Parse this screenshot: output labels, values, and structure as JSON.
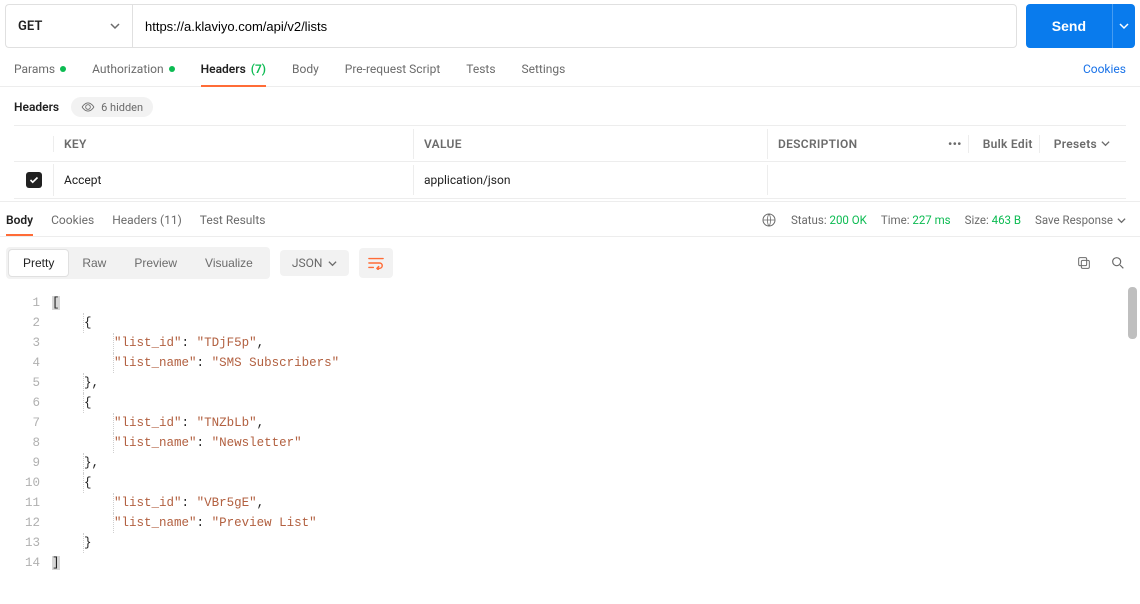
{
  "urlbar": {
    "method": "GET",
    "url": "https://a.klaviyo.com/api/v2/lists",
    "send": "Send"
  },
  "request_tabs": {
    "params": "Params",
    "authorization": "Authorization",
    "headers": "Headers",
    "headers_count": "(7)",
    "body": "Body",
    "prerequest": "Pre-request Script",
    "tests": "Tests",
    "settings": "Settings",
    "cookies": "Cookies"
  },
  "headers_section": {
    "label": "Headers",
    "hidden": "6 hidden",
    "columns": {
      "key": "KEY",
      "value": "VALUE",
      "description": "DESCRIPTION"
    },
    "actions": {
      "bulk_edit": "Bulk Edit",
      "presets": "Presets"
    },
    "rows": [
      {
        "key": "Accept",
        "value": "application/json",
        "description": ""
      }
    ]
  },
  "response_tabs": {
    "body": "Body",
    "cookies": "Cookies",
    "headers": "Headers",
    "headers_count": "(11)",
    "test_results": "Test Results"
  },
  "response_meta": {
    "status_label": "Status:",
    "status_value": "200 OK",
    "time_label": "Time:",
    "time_value": "227 ms",
    "size_label": "Size:",
    "size_value": "463 B",
    "save": "Save Response"
  },
  "response_view": {
    "pretty": "Pretty",
    "raw": "Raw",
    "preview": "Preview",
    "visualize": "Visualize",
    "format": "JSON"
  },
  "response_body": [
    {
      "list_id": "TDjF5p",
      "list_name": "SMS Subscribers"
    },
    {
      "list_id": "TNZbLb",
      "list_name": "Newsletter"
    },
    {
      "list_id": "VBr5gE",
      "list_name": "Preview List"
    }
  ],
  "line_numbers": [
    "1",
    "2",
    "3",
    "4",
    "5",
    "6",
    "7",
    "8",
    "9",
    "10",
    "11",
    "12",
    "13",
    "14"
  ]
}
